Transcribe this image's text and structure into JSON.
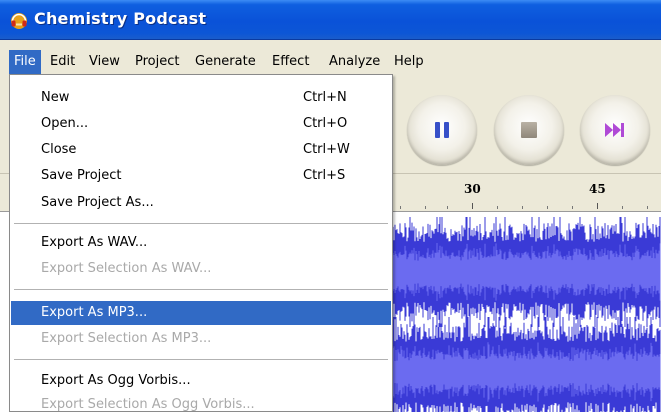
{
  "window": {
    "title": "Chemistry Podcast",
    "icon": "audacity-headphones-icon"
  },
  "menubar": {
    "items": [
      "File",
      "Edit",
      "View",
      "Project",
      "Generate",
      "Effect",
      "Analyze",
      "Help"
    ],
    "active": "File"
  },
  "toolbar": {
    "buttons": [
      "pause-icon",
      "stop-icon",
      "skip-end-icon"
    ]
  },
  "ruler": {
    "labels": [
      "30",
      "45"
    ]
  },
  "file_menu": {
    "items": [
      {
        "label": "New",
        "shortcut": "Ctrl+N",
        "enabled": true
      },
      {
        "label": "Open...",
        "shortcut": "Ctrl+O",
        "enabled": true
      },
      {
        "label": "Close",
        "shortcut": "Ctrl+W",
        "enabled": true
      },
      {
        "label": "Save Project",
        "shortcut": "Ctrl+S",
        "enabled": true
      },
      {
        "label": "Save Project As...",
        "shortcut": "",
        "enabled": true
      },
      {
        "label": "Export As WAV...",
        "shortcut": "",
        "enabled": true
      },
      {
        "label": "Export Selection As WAV...",
        "shortcut": "",
        "enabled": false
      },
      {
        "label": "Export As MP3...",
        "shortcut": "",
        "enabled": true,
        "highlighted": true
      },
      {
        "label": "Export Selection As MP3...",
        "shortcut": "",
        "enabled": false
      },
      {
        "label": "Export As Ogg Vorbis...",
        "shortcut": "",
        "enabled": true
      },
      {
        "label": "Export Selection As Ogg Vorbis...",
        "shortcut": "",
        "enabled": false
      }
    ]
  },
  "colors": {
    "titlebar": "#0a52d8",
    "menu_highlight": "#316ac5",
    "waveform": "#3a3ad6",
    "waveform_light": "#6b6bf0",
    "disabled_text": "#a9a9a9"
  }
}
